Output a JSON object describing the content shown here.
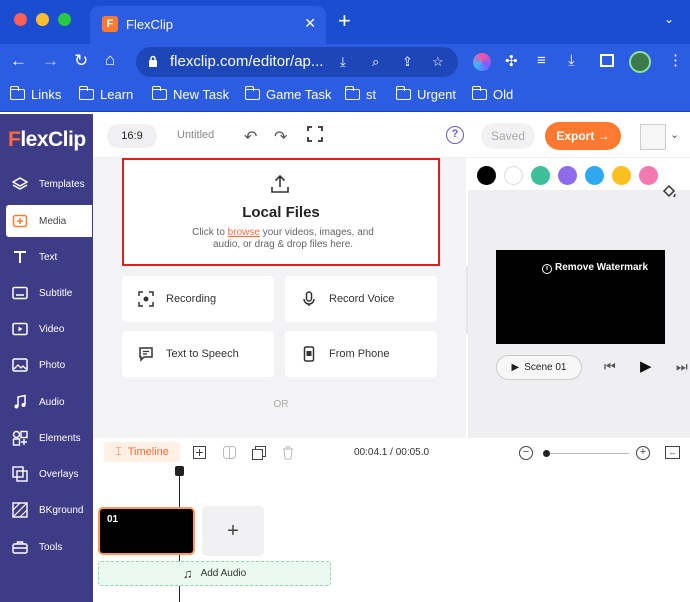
{
  "browser": {
    "tab_title": "FlexClip",
    "tab_favicon": "F",
    "url": "flexclip.com/editor/ap...",
    "bookmarks": [
      "Links",
      "Learn",
      "New Task",
      "Game Task",
      "st",
      "Urgent",
      "Old"
    ]
  },
  "app": {
    "logo": "FlexClip",
    "logo_first": "F",
    "logo_rest": "lexClip",
    "sidebar": [
      {
        "label": "Templates",
        "icon": "layers-icon"
      },
      {
        "label": "Media",
        "icon": "media-plus-icon"
      },
      {
        "label": "Text",
        "icon": "text-icon"
      },
      {
        "label": "Subtitle",
        "icon": "subtitle-icon"
      },
      {
        "label": "Video",
        "icon": "video-icon"
      },
      {
        "label": "Photo",
        "icon": "photo-icon"
      },
      {
        "label": "Audio",
        "icon": "music-icon"
      },
      {
        "label": "Elements",
        "icon": "elements-icon"
      },
      {
        "label": "Overlays",
        "icon": "overlays-icon"
      },
      {
        "label": "BKground",
        "icon": "background-icon"
      },
      {
        "label": "Tools",
        "icon": "toolbox-icon"
      }
    ],
    "active_sidebar": "Media",
    "topbar": {
      "ratio": "16:9",
      "project_name": "Untitled",
      "help": "?",
      "saved": "Saved",
      "export": "Export →"
    },
    "media_panel": {
      "local_title": "Local Files",
      "local_desc_pre": "Click to ",
      "local_desc_link": "browse",
      "local_desc_post": " your videos, images, and audio, or drag & drop files here.",
      "cards": [
        "Recording",
        "Record Voice",
        "Text to Speech",
        "From Phone"
      ],
      "or": "OR"
    },
    "palette": [
      "#000000",
      "#ffffff",
      "#3dbf9a",
      "#8e6be8",
      "#2ea8f0",
      "#fbbf20",
      "#f27ab0"
    ],
    "preview": {
      "watermark": "Remove Watermark",
      "scene": "Scene 01"
    },
    "timeline": {
      "label": "Timeline",
      "time": "00:04.1 / 00:05.0",
      "clip_label": "01",
      "add_clip": "+",
      "add_audio": "Add Audio"
    }
  }
}
